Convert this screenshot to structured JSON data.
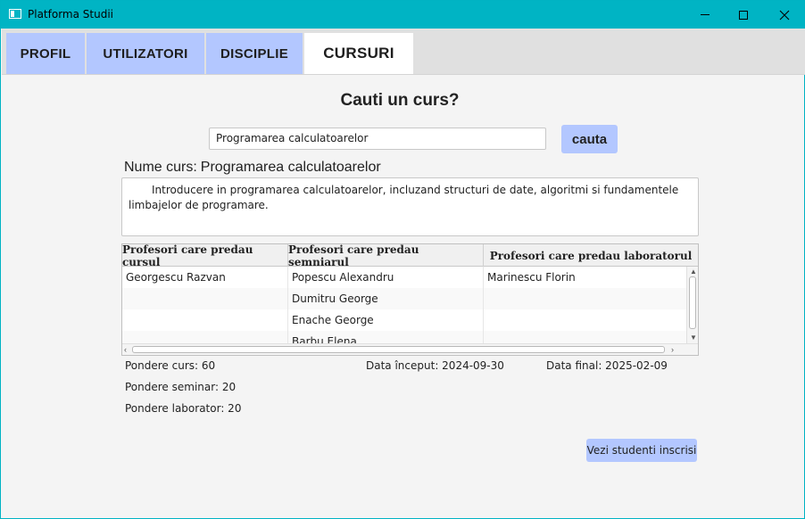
{
  "window": {
    "title": "Platforma Studii",
    "accent_color": "#00b4c4"
  },
  "tabs": {
    "profil": "PROFIL",
    "utilizatori": "UTILIZATORI",
    "discipline": "DISCIPLIE",
    "cursuri": "CURSURI",
    "active": "CURSURI",
    "tab_color": "#b3c7ff"
  },
  "search": {
    "heading": "Cauti un curs?",
    "value": "Programarea calculatoarelor",
    "button_label": "cauta"
  },
  "course": {
    "name_label": "Nume curs:",
    "name": "Programarea calculatoarelor",
    "description": "Introducere in programarea calculatoarelor, incluzand structuri de date, algoritmi si fundamentele limbajelor de programare."
  },
  "table": {
    "headers": [
      "Profesori care predau cursul",
      "Profesori care predau semniarul",
      "Profesori care predau laboratorul"
    ],
    "rows": [
      [
        "Georgescu Razvan",
        "Popescu Alexandru",
        "Marinescu Florin"
      ],
      [
        "",
        "Dumitru George",
        ""
      ],
      [
        "",
        "Enache George",
        ""
      ],
      [
        "",
        "Barbu Elena",
        ""
      ]
    ]
  },
  "details": {
    "pondere_curs": "Pondere curs: 60",
    "pondere_seminar": "Pondere seminar: 20",
    "pondere_laborator": "Pondere laborator: 20",
    "data_inceput": "Data început: 2024-09-30",
    "data_final": "Data final: 2025-02-09"
  },
  "actions": {
    "students_button": "Vezi studenti inscrisi"
  }
}
